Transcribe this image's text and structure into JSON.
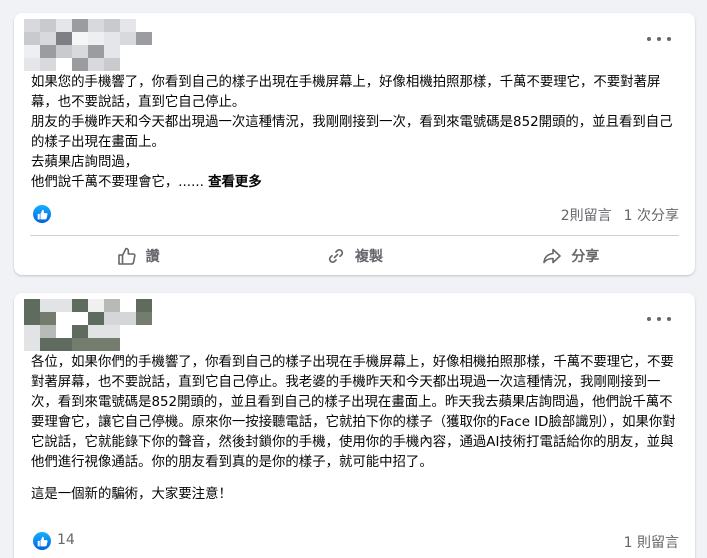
{
  "theme": {
    "accent": "#1877f2",
    "secondary_text": "#65676b",
    "background": "#f0f2f5"
  },
  "posts": [
    {
      "author_hidden": true,
      "more_icon": "more-horizontal-icon",
      "paragraphs": [
        "如果您的手機響了，你看到自己的樣子出現在手機屏幕上，好像相機拍照那樣，千萬不要理它，不要對著屏幕，也不要說話，直到它自己停止。",
        "朋友的手機昨天和今天都出現過一次這種情況，我剛剛接到一次，看到來電號碼是852開頭的，並且看到自己的樣子出現在畫面上。",
        "去蘋果店詢問過，",
        "他們說千萬不要理會它，......"
      ],
      "see_more": "查看更多",
      "comments": "2則留言",
      "shares": "1 次分享",
      "actions": [
        {
          "label": "讚",
          "icon": "thumbs-up-icon"
        },
        {
          "label": "複製",
          "icon": "link-icon"
        },
        {
          "label": "分享",
          "icon": "share-icon"
        }
      ]
    },
    {
      "author_hidden": true,
      "more_icon": "more-horizontal-icon",
      "paragraphs": [
        "各位，如果你們的手機響了，你看到自己的樣子出現在手機屏幕上，好像相機拍照那樣，千萬不要理它，不要對著屏幕，也不要說話，直到它自己停止。我老婆的手機昨天和今天都出現過一次這種情況，我剛剛接到一次，看到來電號碼是852開頭的，並且看到自己的樣子出現在畫面上。昨天我去蘋果店詢問過，他們說千萬不要理會它，讓它自己停機。原來你一按接聽電話，它就拍下你的樣子（獲取你的Face ID臉部識別），如果你對它說話，它就能錄下你的聲音，然後封鎖你的手機，使用你的手機內容，通過AI技術打電話給你的朋友，並與他們進行視像通話。你的朋友看到真的是你的樣子，就可能中招了。",
        "這是一個新的騙術，大家要注意！"
      ],
      "reactions": "14",
      "comments": "1 則留言"
    }
  ]
}
